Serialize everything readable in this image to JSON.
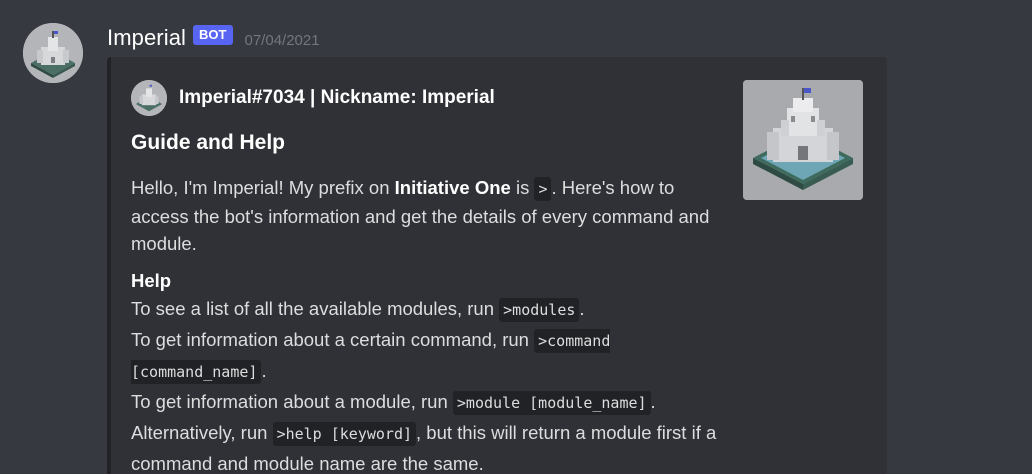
{
  "message": {
    "username": "Imperial",
    "bot_tag": "BOT",
    "timestamp": "07/04/2021"
  },
  "embed": {
    "author": "Imperial#7034 | Nickname: Imperial",
    "title": "Guide and Help",
    "description": {
      "part1": "Hello, I'm Imperial! My prefix on ",
      "server_name": "Initiative One",
      "part2": " is ",
      "prefix": ">",
      "part3": ". Here's how to access the bot's information and get the details of every command and module."
    },
    "field": {
      "name": "Help",
      "line1_text": "To see a list of all the available modules, run ",
      "line1_code": ">modules",
      "line1_end": ".",
      "line2_text": "To get information about a certain command, run ",
      "line2_code": ">command [command_name]",
      "line2_end": ".",
      "line3_text": "To get information about a module, run ",
      "line3_code": ">module [module_name]",
      "line3_end": ".",
      "line4_text": "Alternatively, run ",
      "line4_code": ">help [keyword]",
      "line4_end": ", but this will return a module first if a command and module name are the same."
    }
  },
  "colors": {
    "background": "#36393f",
    "embed_background": "#2f3136",
    "bot_tag": "#5865f2",
    "timestamp": "#72767d"
  },
  "icons": {
    "avatar": "castle-avatar-icon",
    "author_icon": "castle-icon",
    "thumbnail": "castle-thumbnail"
  }
}
